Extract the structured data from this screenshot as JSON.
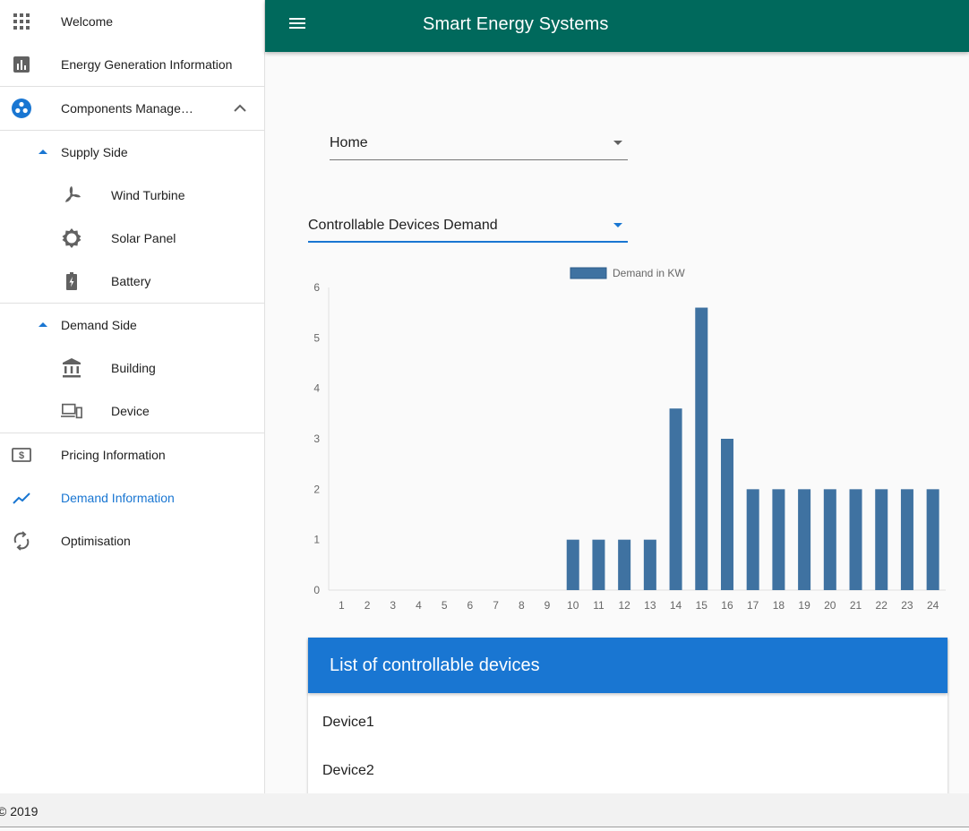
{
  "app": {
    "title": "Smart Energy Systems"
  },
  "sidebar": {
    "welcome": "Welcome",
    "energy_generation": "Energy Generation Information",
    "components_management": "Components Manage…",
    "supply_side": "Supply Side",
    "wind_turbine": "Wind Turbine",
    "solar_panel": "Solar Panel",
    "battery": "Battery",
    "demand_side": "Demand Side",
    "building": "Building",
    "device": "Device",
    "pricing_information": "Pricing Information",
    "demand_information": "Demand Information",
    "optimisation": "Optimisation"
  },
  "filters": {
    "location": "Home",
    "view": "Controllable Devices Demand"
  },
  "chart_data": {
    "type": "bar",
    "legend": "Demand in KW",
    "categories": [
      "1",
      "2",
      "3",
      "4",
      "5",
      "6",
      "7",
      "8",
      "9",
      "10",
      "11",
      "12",
      "13",
      "14",
      "15",
      "16",
      "17",
      "18",
      "19",
      "20",
      "21",
      "22",
      "23",
      "24"
    ],
    "values": [
      0,
      0,
      0,
      0,
      0,
      0,
      0,
      0,
      0,
      1,
      1,
      1,
      1,
      3.6,
      5.6,
      3,
      2,
      2,
      2,
      2,
      2,
      2,
      2,
      2
    ],
    "ylim": [
      0,
      6
    ],
    "yticks": [
      0,
      1,
      2,
      3,
      4,
      5,
      6
    ],
    "bar_color": "#3f72a1",
    "legend_position": "top-center"
  },
  "device_panel": {
    "title": "List of controllable devices",
    "items": [
      "Device1",
      "Device2"
    ]
  },
  "footer": {
    "copyright": "© 2019"
  },
  "colors": {
    "appbar": "#00695c",
    "accent": "#1976d2"
  }
}
